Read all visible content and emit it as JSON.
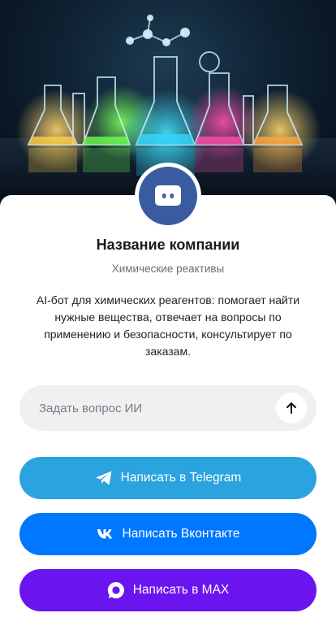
{
  "hero": {
    "image_alt": "chemistry-lab-flasks"
  },
  "avatar": {
    "icon": "chat-bubble-icon",
    "color": "#3b5ba1"
  },
  "company": {
    "name": "Название компании",
    "category": "Химические реактивы"
  },
  "description": "AI-бот для химических реагентов: помогает найти нужные вещества, отвечает на вопросы по применению и безопасности, консультирует по заказам.",
  "ask": {
    "placeholder": "Задать вопрос ИИ",
    "send_icon": "arrow-up-icon"
  },
  "buttons": {
    "telegram": {
      "label": "Написать в Telegram",
      "icon": "telegram-icon",
      "color": "#2aa3df"
    },
    "vk": {
      "label": "Написать Вконтакте",
      "icon": "vk-icon",
      "color": "#0077ff"
    },
    "max": {
      "label": "Написать в MAX",
      "icon": "max-icon",
      "color": "#6a14f0"
    }
  }
}
